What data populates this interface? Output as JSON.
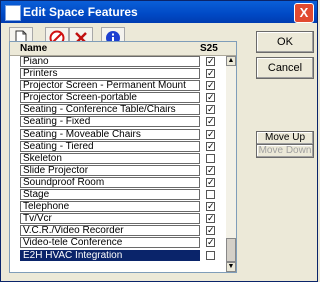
{
  "window": {
    "title": "Edit Space Features",
    "close_glyph": "X",
    "icons": [
      "window-icon",
      "close-icon"
    ]
  },
  "toolbar": {
    "buttons": [
      "new-document-icon",
      "no-entry-icon",
      "delete-x-icon",
      "info-icon"
    ]
  },
  "grid": {
    "columns": {
      "name": "Name",
      "s25": "S25"
    },
    "rows": [
      {
        "name": "Piano",
        "checked": true,
        "check_glyph": "✓"
      },
      {
        "name": "Printers",
        "checked": true,
        "check_glyph": "✓"
      },
      {
        "name": "Projector Screen - Permanent Mount",
        "checked": true,
        "check_glyph": "✓"
      },
      {
        "name": "Projector Screen-portable",
        "checked": true,
        "check_glyph": "✓"
      },
      {
        "name": "Seating - Conference Table/Chairs",
        "checked": true,
        "check_glyph": "✓"
      },
      {
        "name": "Seating - Fixed",
        "checked": true,
        "check_glyph": "✓"
      },
      {
        "name": "Seating - Moveable Chairs",
        "checked": true,
        "check_glyph": "✓"
      },
      {
        "name": "Seating - Tiered",
        "checked": true,
        "check_glyph": "✓"
      },
      {
        "name": "Skeleton",
        "checked": false,
        "check_glyph": ""
      },
      {
        "name": "Slide Projector",
        "checked": true,
        "check_glyph": "✓"
      },
      {
        "name": "Soundproof Room",
        "checked": true,
        "check_glyph": "✓"
      },
      {
        "name": "Stage",
        "checked": false,
        "check_glyph": ""
      },
      {
        "name": "Telephone",
        "checked": true,
        "check_glyph": "✓"
      },
      {
        "name": "Tv/Vcr",
        "checked": true,
        "check_glyph": "✓"
      },
      {
        "name": "V.C.R./Video Recorder",
        "checked": true,
        "check_glyph": "✓"
      },
      {
        "name": "Video-tele Conference",
        "checked": true,
        "check_glyph": "✓"
      },
      {
        "name": "E2H HVAC Integration",
        "checked": false,
        "check_glyph": "",
        "selected": true
      }
    ],
    "scrollbar": {
      "up_glyph": "▲",
      "down_glyph": "▼"
    }
  },
  "actions": {
    "ok": "OK",
    "cancel": "Cancel",
    "move_up": "Move Up",
    "move_down": "Move Down"
  },
  "colors": {
    "title_bar": "#0049c5",
    "selection": "#0a246a",
    "dialog_bg": "#ece9d8"
  }
}
